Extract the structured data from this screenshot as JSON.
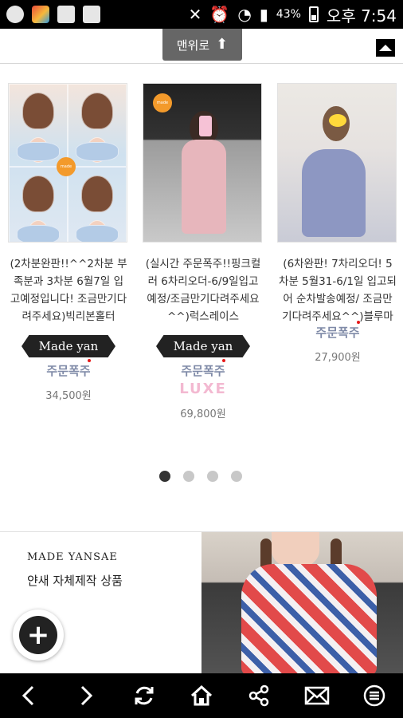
{
  "status_bar": {
    "battery": "43%",
    "time": "오후 7:54"
  },
  "top": {
    "to_top_label": "맨위로"
  },
  "products": [
    {
      "title": "(2차분완판!!^^2차분 부족분과 3차분 6월7일 입고예정입니다! 조금만기다려주세요)빅리본홀터",
      "brand_badge": "Made yan",
      "status_badge": "주문폭주",
      "extra_label": "",
      "price": "34,500원"
    },
    {
      "title": "(실시간 주문폭주!!핑크컬러 6차리오더-6/9일입고예정/조금만기다려주세요^^)럭스레이스",
      "brand_badge": "Made yan",
      "status_badge": "주문폭주",
      "extra_label": "LUXE",
      "price": "69,800원"
    },
    {
      "title": "(6차완판! 7차리오더! 5차분 5월31-6/1일 입고되어 순차발송예정/ 조금만기다려주세요^^)블루마린",
      "brand_badge": "",
      "status_badge": "주문폭주",
      "extra_label": "",
      "price": "27,900원"
    }
  ],
  "carousel": {
    "page_count": 4,
    "active_index": 0
  },
  "banner": {
    "brand": "MADE YANSAE",
    "subtitle": "얀새 자체제작 상품"
  },
  "icons": {
    "fab": "plus-icon",
    "nav": [
      "back-icon",
      "forward-icon",
      "refresh-icon",
      "home-icon",
      "share-icon",
      "mail-icon",
      "menu-icon"
    ]
  }
}
